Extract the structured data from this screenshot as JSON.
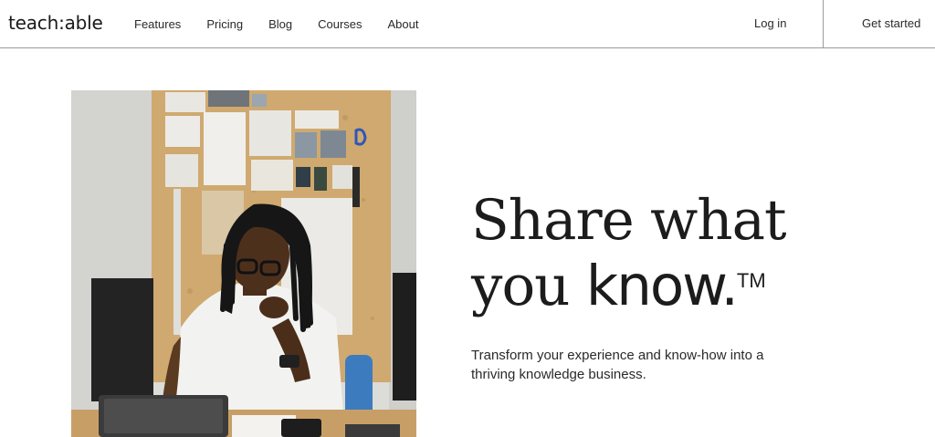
{
  "header": {
    "logo": "teach:able",
    "nav": [
      "Features",
      "Pricing",
      "Blog",
      "Courses",
      "About"
    ],
    "login_label": "Log in",
    "cta_label": "Get started"
  },
  "hero": {
    "headline_line1": "Share what",
    "headline_line2_prefix": "you ",
    "headline_bold": "know.",
    "trademark": "TM",
    "subtitle": "Transform your experience and know-how into a thriving knowledge business."
  }
}
